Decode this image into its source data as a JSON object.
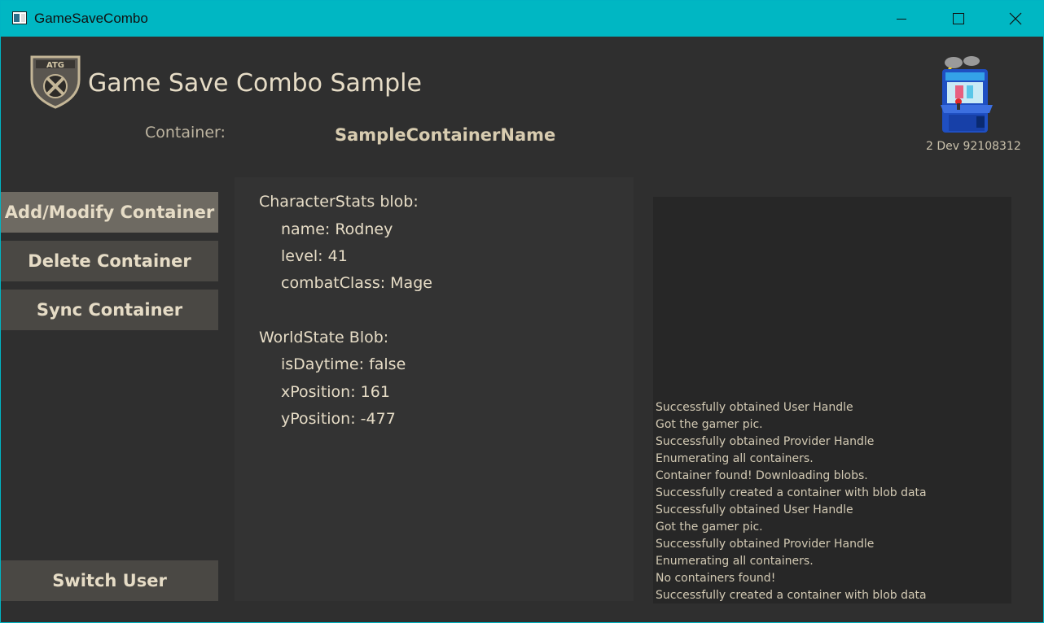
{
  "window": {
    "title": "GameSaveCombo",
    "controls": {
      "minimize": "minimize-icon",
      "maximize": "maximize-icon",
      "close": "close-icon"
    }
  },
  "header": {
    "logo_text": "ATG",
    "title": "Game Save Combo Sample",
    "container_label": "Container:",
    "container_name": "SampleContainerName",
    "dev_id": "2 Dev 92108312"
  },
  "sidebar": {
    "buttons": [
      {
        "label": "Add/Modify Container",
        "active": true
      },
      {
        "label": "Delete Container",
        "active": false
      },
      {
        "label": "Sync Container",
        "active": false
      }
    ],
    "switch_user": "Switch User"
  },
  "blobs": {
    "character": {
      "title": "CharacterStats blob:",
      "fields": [
        "name: Rodney",
        "level: 41",
        "combatClass: Mage"
      ]
    },
    "world": {
      "title": "WorldState Blob:",
      "fields": [
        "isDaytime: false",
        "xPosition: 161",
        "yPosition: -477"
      ]
    }
  },
  "log": {
    "lines": [
      "Successfully obtained User Handle",
      "Got the gamer pic.",
      "Successfully obtained Provider Handle",
      "Enumerating all containers.",
      "Container found! Downloading blobs.",
      "Successfully created a container with blob data",
      "Successfully obtained User Handle",
      "Got the gamer pic.",
      "Successfully obtained Provider Handle",
      "Enumerating all containers.",
      "No containers found!",
      "Successfully created a container with blob data"
    ]
  },
  "colors": {
    "titlebar": "#00b7c3",
    "background": "#2f2f2f",
    "text": "#e6dcc6",
    "button": "#4a4844",
    "button_active": "#6e6a62"
  }
}
